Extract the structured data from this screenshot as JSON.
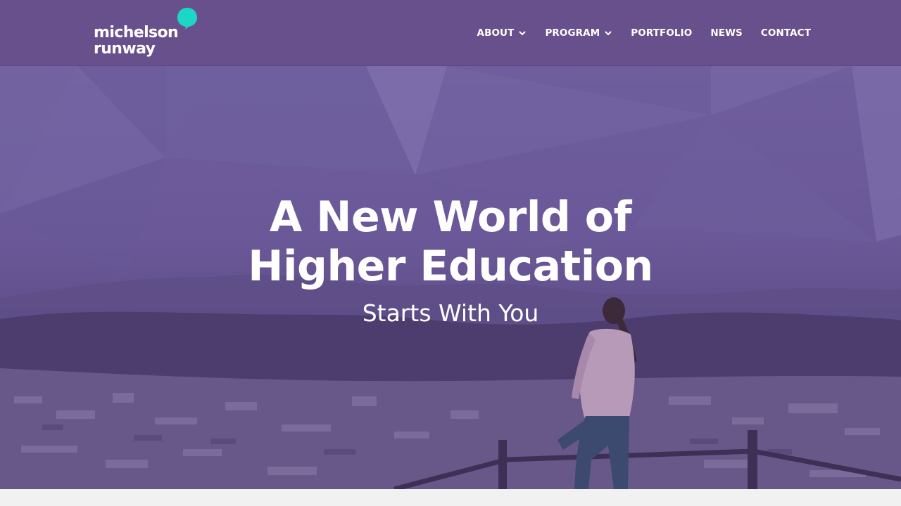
{
  "brand": {
    "line1": "michelson",
    "line2": "runway",
    "bubble_color": "#1dd6c6"
  },
  "nav": {
    "items": [
      {
        "label": "ABOUT",
        "has_dropdown": true
      },
      {
        "label": "PROGRAM",
        "has_dropdown": true
      },
      {
        "label": "PORTFOLIO",
        "has_dropdown": false
      },
      {
        "label": "NEWS",
        "has_dropdown": false
      },
      {
        "label": "CONTACT",
        "has_dropdown": false
      }
    ]
  },
  "hero": {
    "title_line1": "A New World of",
    "title_line2": "Higher Education",
    "subtitle": "Starts With You"
  },
  "colors": {
    "header_bg": "#68508c",
    "hero_overlay": "#6a5898",
    "text": "#ffffff"
  }
}
